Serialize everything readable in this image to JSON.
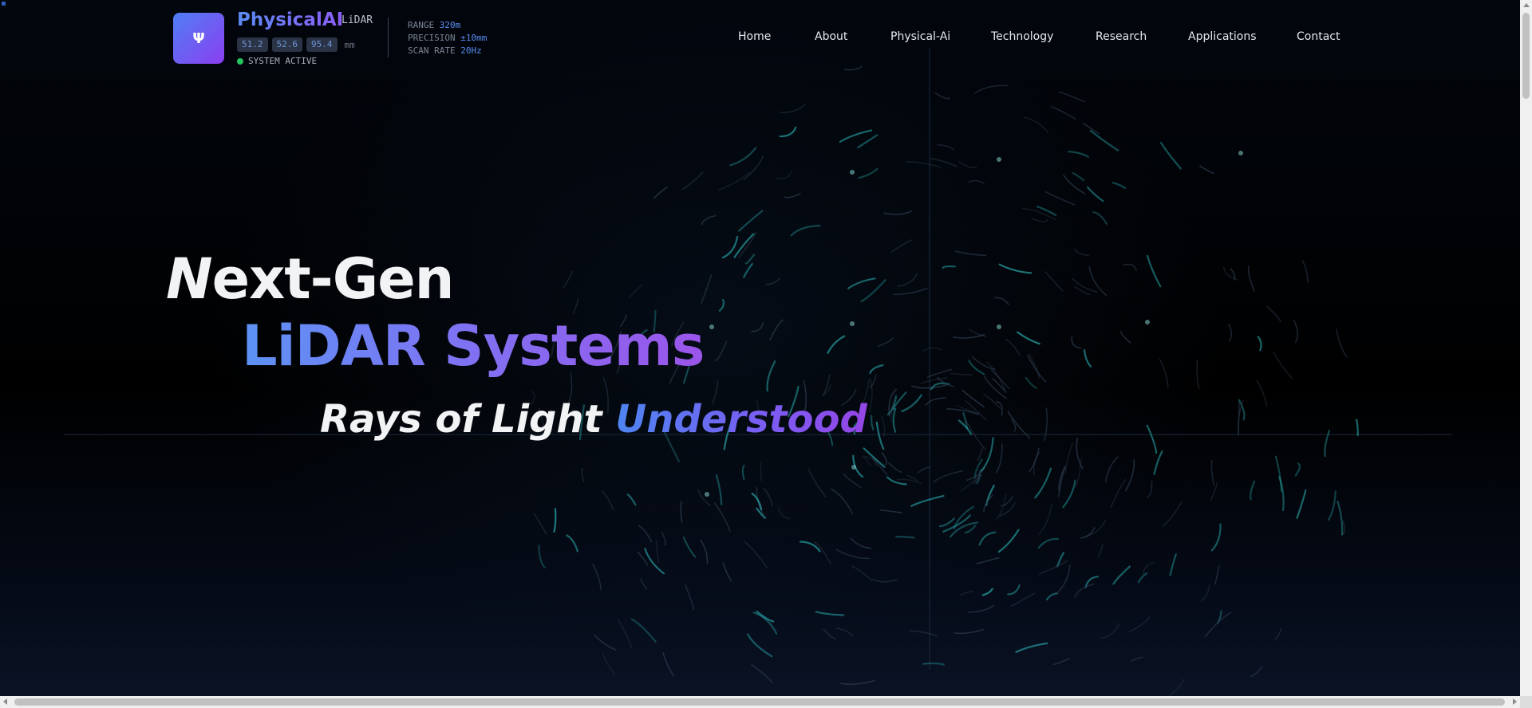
{
  "brand": {
    "logo_glyph": "Ψ",
    "name": "PhysicalAI",
    "tag": "LiDAR",
    "coordinates": [
      "51.2",
      "52.6",
      "95.4"
    ],
    "coordinate_unit": "mm",
    "status": "SYSTEM ACTIVE"
  },
  "specs": [
    {
      "label": "RANGE",
      "value": "320m"
    },
    {
      "label": "PRECISION",
      "value": "±10mm"
    },
    {
      "label": "SCAN RATE",
      "value": "20Hz"
    }
  ],
  "nav": {
    "items": [
      {
        "label": "Home"
      },
      {
        "label": "About"
      },
      {
        "label": "Physical-Ai"
      },
      {
        "label": "Technology"
      },
      {
        "label": "Research"
      },
      {
        "label": "Applications"
      },
      {
        "label": "Contact"
      }
    ]
  },
  "hero": {
    "line1_first": "N",
    "line1_rest": "ext-Gen",
    "line2": "LiDAR Systems",
    "line3_main": "Rays of Light ",
    "line3_accent": "Understood"
  },
  "colors": {
    "accent_blue": "#5b8cf5",
    "accent_purple": "#8b5cf6",
    "status_green": "#22c55e",
    "scan_teal": "#2ec4c6"
  },
  "icons": {
    "status": "status-dot-icon",
    "logo": "psi-logo-icon"
  }
}
